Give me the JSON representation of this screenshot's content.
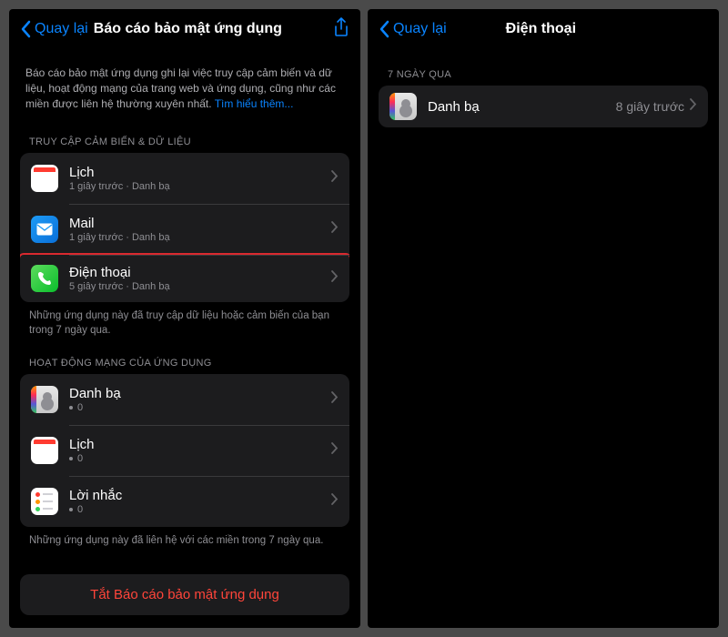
{
  "left": {
    "back": "Quay lại",
    "title": "Báo cáo bảo mật ứng dụng",
    "intro": "Báo cáo bảo mật ứng dụng ghi lại việc truy cập cảm biến và dữ liệu, hoạt động mạng của trang web và ứng dụng, cũng như các miền được liên hệ thường xuyên nhất. ",
    "learn_more": "Tìm hiểu thêm...",
    "section_sensor": "TRUY CẬP CẢM BIẾN & DỮ LIỆU",
    "sensor_items": [
      {
        "name": "Lịch",
        "sub": "1 giây trước · Danh bạ"
      },
      {
        "name": "Mail",
        "sub": "1 giây trước · Danh bạ"
      },
      {
        "name": "Điện thoại",
        "sub": "5 giây trước · Danh bạ"
      }
    ],
    "sensor_footer": "Những ứng dụng này đã truy cập dữ liệu hoặc cảm biến của bạn trong 7 ngày qua.",
    "section_network": "HOẠT ĐỘNG MẠNG CỦA ỨNG DỤNG",
    "network_items": [
      {
        "name": "Danh bạ",
        "sub": "0"
      },
      {
        "name": "Lịch",
        "sub": "0"
      },
      {
        "name": "Lời nhắc",
        "sub": "0"
      }
    ],
    "network_footer": "Những ứng dụng này đã liên hệ với các miền trong 7 ngày qua.",
    "turn_off": "Tắt Báo cáo bảo mật ứng dụng"
  },
  "right": {
    "back": "Quay lại",
    "title": "Điện thoại",
    "section": "7 NGÀY QUA",
    "items": [
      {
        "name": "Danh bạ",
        "time": "8 giây trước"
      }
    ]
  }
}
